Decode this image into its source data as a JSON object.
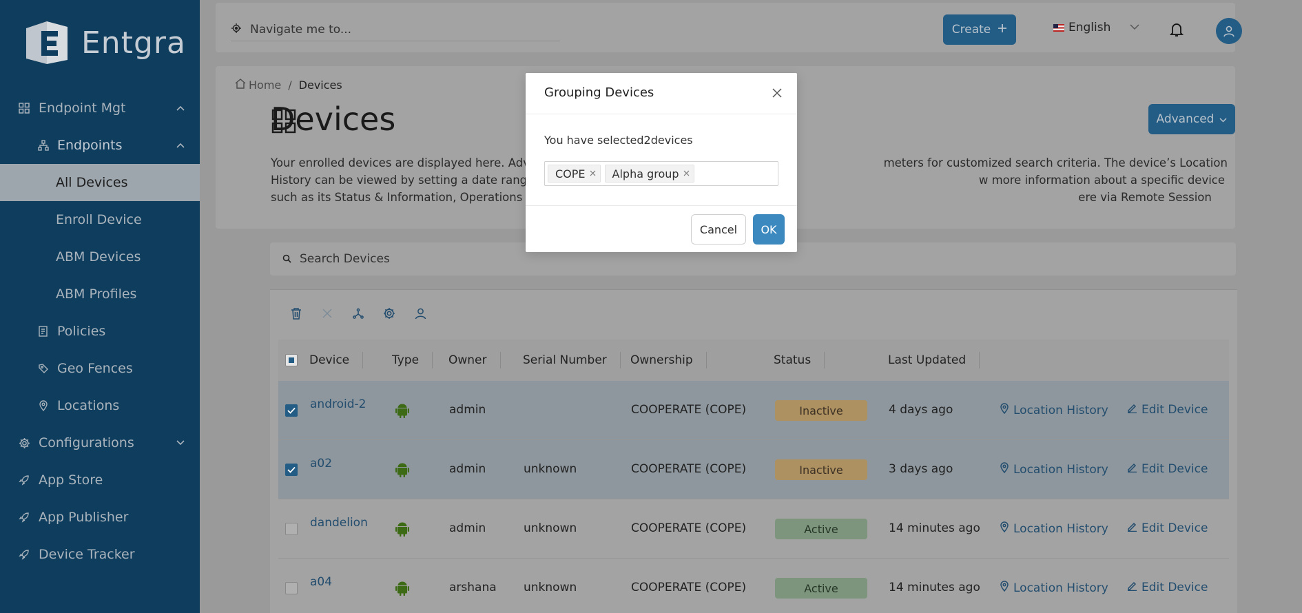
{
  "app": {
    "brand": "Entgra"
  },
  "sidebar": {
    "items": [
      {
        "label": "Endpoint Mgt",
        "icon": "grid-icon",
        "chevron": "^"
      },
      {
        "label": "Endpoints",
        "icon": "hierarchy-icon",
        "chevron": "^"
      },
      {
        "label": "All Devices"
      },
      {
        "label": "Enroll Device"
      },
      {
        "label": "ABM Devices"
      },
      {
        "label": "ABM Profiles"
      },
      {
        "label": "Policies",
        "icon": "policy-icon"
      },
      {
        "label": "Geo Fences",
        "icon": "geofence-icon"
      },
      {
        "label": "Locations",
        "icon": "location-pin-icon"
      },
      {
        "label": "Configurations",
        "icon": "gear-icon",
        "chevron": "v"
      },
      {
        "label": "App Store",
        "icon": "rocket-icon"
      },
      {
        "label": "App Publisher",
        "icon": "rocket-icon"
      },
      {
        "label": "Device Tracker",
        "icon": "rocket-icon"
      }
    ]
  },
  "topbar": {
    "nav_placeholder": "Navigate me to...",
    "create_label": "Create",
    "language": "English"
  },
  "header": {
    "breadcrumb_home": "Home",
    "breadcrumb_sep": "/",
    "breadcrumb_current": "Devices",
    "title": "Devices",
    "advanced_label": "Advanced",
    "description": "Your enrolled devices are displayed here. Adva                                                                                                meters for customized search criteria. The device’s Location History can be viewed by setting a date range, the period for w                                                                                                w more information about a specific device such as its Status & Information, Operations Logand Policy Compliance by clickin                                                                                                ere via Remote Session and install apps by clicking Apps."
  },
  "search": {
    "placeholder": "Search Devices"
  },
  "table": {
    "columns": [
      "Device",
      "Type",
      "Owner",
      "Serial Number",
      "Ownership",
      "Status",
      "Last Updated"
    ],
    "rows": [
      {
        "device": "android-2",
        "owner": "admin",
        "serial": "",
        "ownership": "COOPERATE (COPE)",
        "status": "Inactive",
        "updated": "4 days ago",
        "selected": true
      },
      {
        "device": "a02",
        "owner": "admin",
        "serial": "unknown",
        "ownership": "COOPERATE (COPE)",
        "status": "Inactive",
        "updated": "3 days ago",
        "selected": true
      },
      {
        "device": "dandelion",
        "owner": "admin",
        "serial": "unknown",
        "ownership": "COOPERATE (COPE)",
        "status": "Active",
        "updated": "14 minutes ago",
        "selected": false
      },
      {
        "device": "a04",
        "owner": "arshana",
        "serial": "unknown",
        "ownership": "COOPERATE (COPE)",
        "status": "Active",
        "updated": "14 minutes ago",
        "selected": false
      }
    ],
    "location_history_label": "Location History",
    "edit_device_label": "Edit Device"
  },
  "modal": {
    "title": "Grouping Devices",
    "message": "You have selected2devices",
    "tags": [
      "COPE",
      "Alpha group"
    ],
    "cancel_label": "Cancel",
    "ok_label": "OK"
  },
  "colors": {
    "sidebar_bg": "#0f3d5e",
    "accent": "#235c84",
    "ok_button": "#3c89c0",
    "inactive_badge": "#ad9161",
    "active_badge": "#7d957d"
  }
}
